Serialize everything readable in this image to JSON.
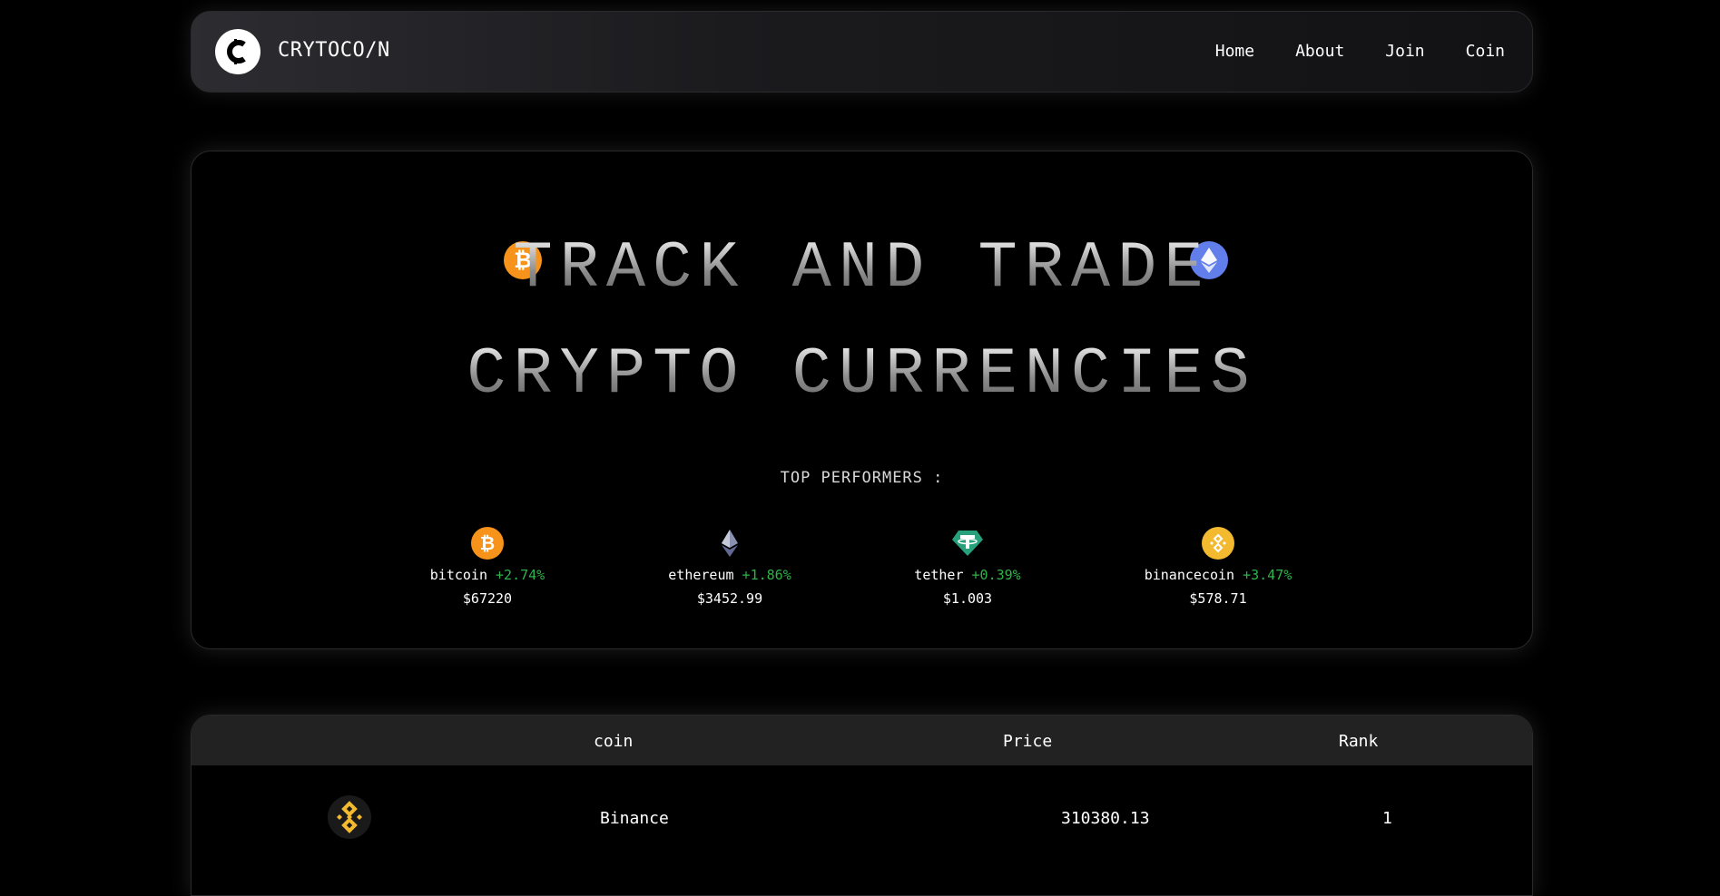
{
  "nav": {
    "brand": "CRYTOCO/N",
    "links": [
      "Home",
      "About",
      "Join",
      "Coin"
    ]
  },
  "hero": {
    "line1": "TRACK AND TRADE",
    "line2": "CRYPTO CURRENCIES",
    "top_label": "TOP PERFORMERS :",
    "performers": [
      {
        "name": "bitcoin",
        "change": "+2.74%",
        "price": "$67220",
        "icon": "bitcoin-icon"
      },
      {
        "name": "ethereum",
        "change": "+1.86%",
        "price": "$3452.99",
        "icon": "ethereum-icon"
      },
      {
        "name": "tether",
        "change": "+0.39%",
        "price": "$1.003",
        "icon": "tether-icon"
      },
      {
        "name": "binancecoin",
        "change": "+3.47%",
        "price": "$578.71",
        "icon": "binancecoin-icon"
      }
    ]
  },
  "table": {
    "headers": [
      "coin",
      "Price",
      "Rank"
    ],
    "rows": [
      {
        "coin": "Binance",
        "price": "310380.13",
        "rank": "1",
        "icon": "binance-icon"
      }
    ]
  },
  "colors": {
    "positive": "#2fb34a",
    "bitcoin": "#f7931a",
    "ethereum": "#627eea",
    "tether": "#26a17b",
    "binance": "#f3ba2f"
  }
}
